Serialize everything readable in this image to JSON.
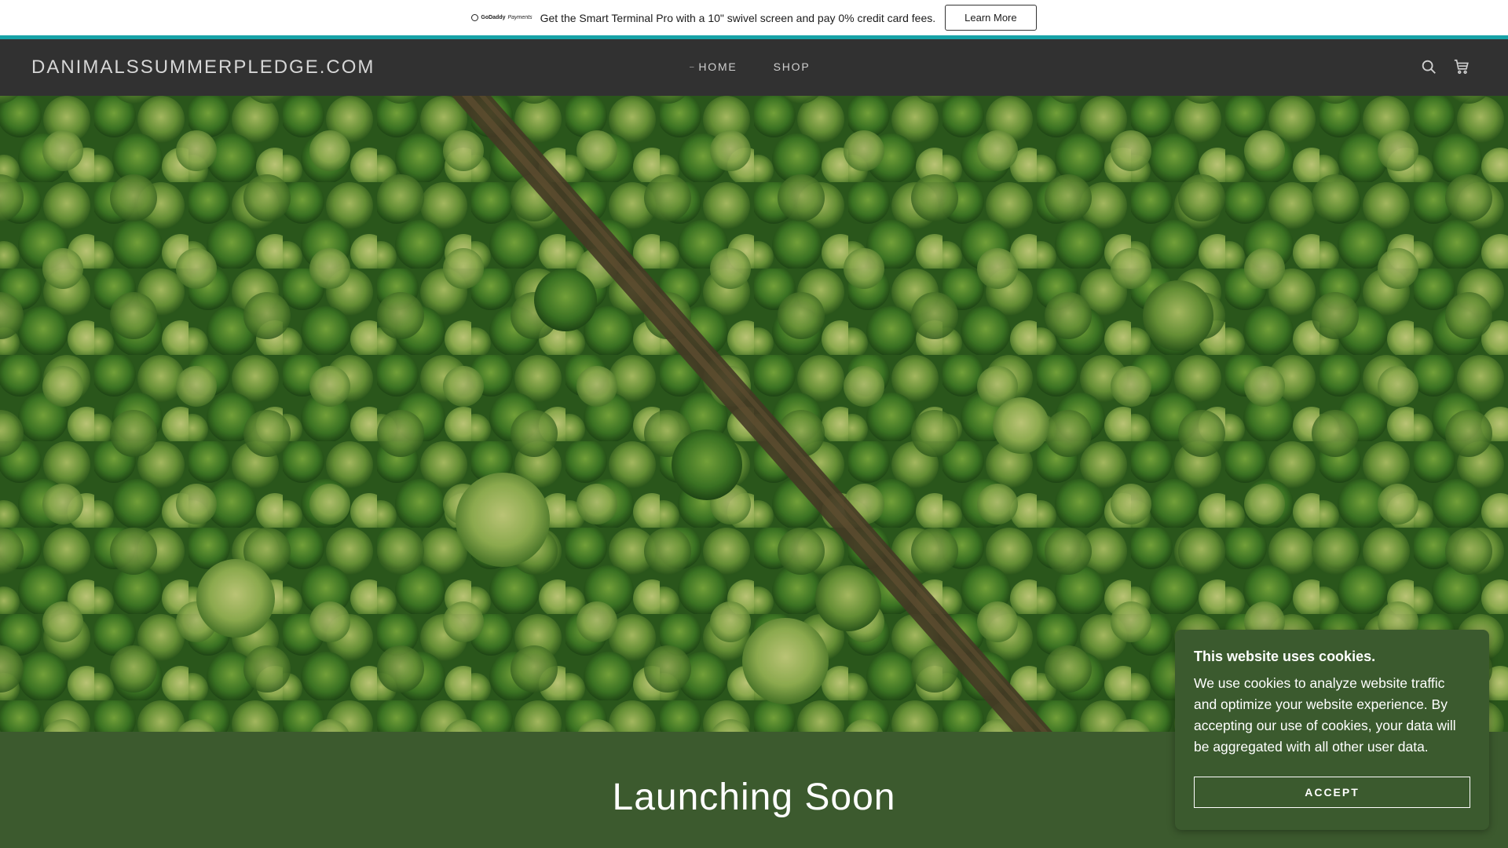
{
  "promo": {
    "logo_text": "GoDaddy",
    "logo_sub": "Payments",
    "message": "Get the Smart Terminal Pro with a 10\" swivel screen and pay 0% credit card fees.",
    "button_label": "Learn More"
  },
  "header": {
    "site_title": "DANIMALSSUMMERPLEDGE.COM",
    "nav": [
      {
        "label": "HOME",
        "active": true
      },
      {
        "label": "SHOP",
        "active": false
      }
    ],
    "icons": [
      "search-icon",
      "cart-icon"
    ]
  },
  "hero": {
    "image": "aerial forest with dirt path"
  },
  "main": {
    "heading": "Launching Soon"
  },
  "cookie_banner": {
    "title": "This website uses cookies.",
    "body": "We use cookies to analyze website traffic and optimize your website experience. By accepting our use of cookies, your data will be aggregated with all other user data.",
    "accept_label": "ACCEPT"
  },
  "colors": {
    "teal": "#17a2a7",
    "header_bg": "#313131",
    "band_green": "#3c5a2e"
  }
}
